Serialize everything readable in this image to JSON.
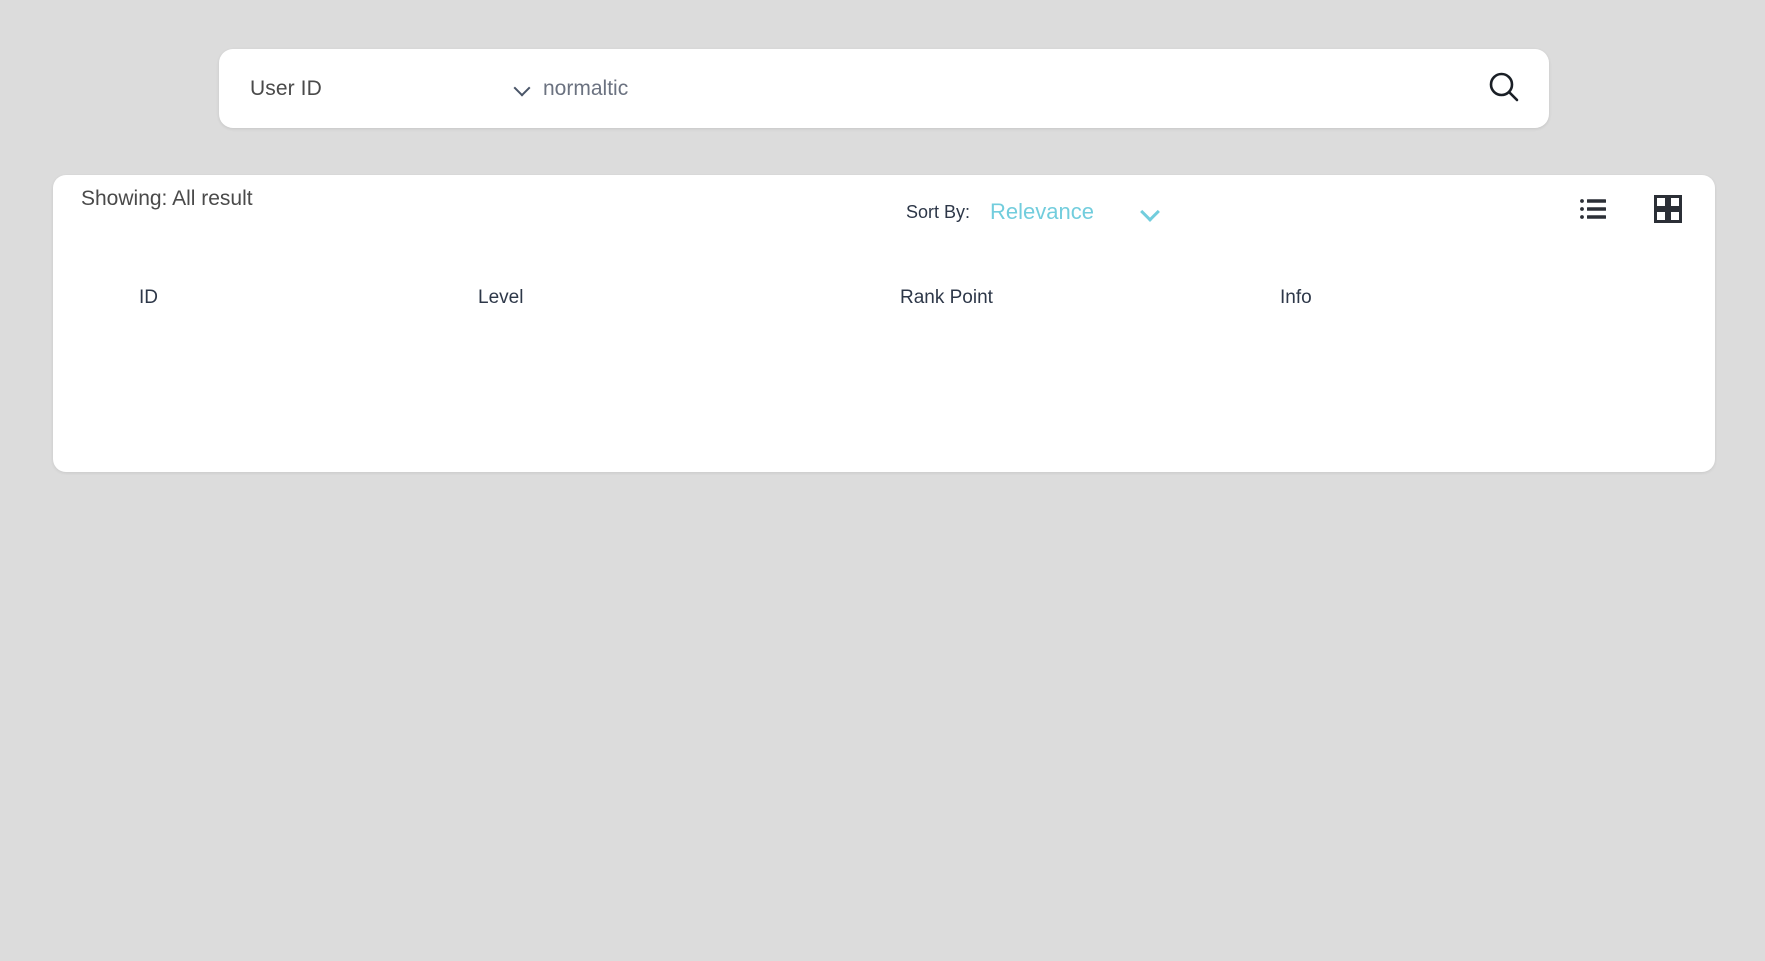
{
  "page": {
    "background_color": "#dcdcdc",
    "accent_color": "#72cddd"
  },
  "search": {
    "type_selector": {
      "label": "User ID",
      "icon": "chevron-down-icon"
    },
    "query_value": "normaltic",
    "placeholder": "",
    "submit_icon": "search-icon"
  },
  "results": {
    "showing_label": "Showing: All result",
    "sort": {
      "label": "Sort By:",
      "value": "Relevance",
      "icon": "chevron-down-icon"
    },
    "view_modes": [
      {
        "name": "list-view",
        "icon": "list-view-icon",
        "active": false
      },
      {
        "name": "grid-view",
        "icon": "grid-view-icon",
        "active": true
      }
    ],
    "table": {
      "columns": [
        "ID",
        "Level",
        "Rank Point",
        "Info"
      ],
      "rows": []
    }
  }
}
